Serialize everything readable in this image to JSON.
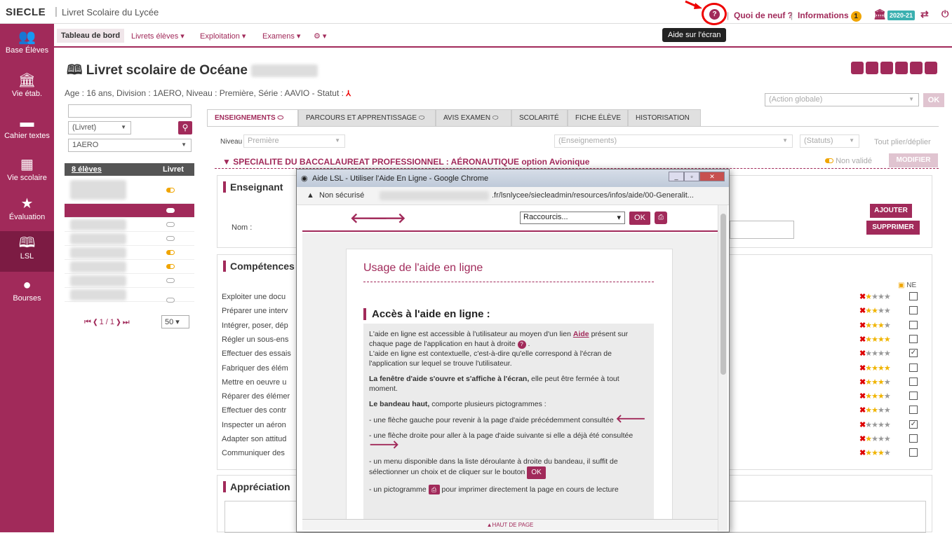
{
  "header": {
    "brand": "SIECLE",
    "separator": "|",
    "app_title": "Livret Scolaire du Lycée",
    "whats_new": "Quoi de neuf ?",
    "divider1": "|",
    "divider2": "|",
    "informations": "Informations",
    "info_count": "1",
    "year": "2020-21",
    "tooltip": "Aide sur l'écran"
  },
  "sidebar": {
    "items": [
      {
        "label": "Base Élèves",
        "icon": "students-icon"
      },
      {
        "label": "Vie étab.",
        "icon": "institution-icon"
      },
      {
        "label": "Cahier textes",
        "icon": "book-icon"
      },
      {
        "label": "Vie scolaire",
        "icon": "calendar-icon"
      },
      {
        "label": "Évaluation",
        "icon": "star-icon"
      },
      {
        "label": "LSL",
        "icon": "open-book-icon"
      },
      {
        "label": "Bourses",
        "icon": "bag-icon"
      }
    ]
  },
  "menu": {
    "dashboard": "Tableau de bord",
    "livrets": "Livrets élèves ▾",
    "exploitation": "Exploitation ▾",
    "examens": "Examens ▾",
    "settings": "⚙ ▾"
  },
  "page": {
    "title": "Livret scolaire de Océane",
    "subinfo": "Age : 16 ans, Division : 1AERO, Niveau : Première, Série : AAVIO - Statut :",
    "action_global": "(Action globale)",
    "ok": "OK"
  },
  "left": {
    "livret_select": "(Livret)",
    "division_select": "1AERO",
    "students_head": "8 élèves",
    "livret_col": "Livret",
    "pager": "⏮ ❮ 1 / 1 ❯ ⏭",
    "per_page": "50"
  },
  "tabs": [
    "ENSEIGNEMENTS",
    "PARCOURS ET APPRENTISSAGE",
    "AVIS EXAMEN",
    "SCOLARITÉ",
    "FICHE ÉLÈVE",
    "HISTORISATION"
  ],
  "filters": {
    "niveau_label": "Niveau",
    "niveau": "Première",
    "enseignements": "(Enseignements)",
    "statuts": "(Statuts)",
    "plier": "Tout plier/déplier"
  },
  "spec": {
    "title": "▼ SPECIALITE DU BACCALAUREAT PROFESSIONNEL : AÉRONAUTIQUE option Avionique",
    "non_valide": "Non validé",
    "modifier": "MODIFIER"
  },
  "enseignant": {
    "title": "Enseignant",
    "nom_label": "Nom :",
    "ajouter": "AJOUTER",
    "supprimer": "SUPPRIMER"
  },
  "competences": {
    "title": "Compétences",
    "ne": "NE",
    "items": [
      {
        "label": "Exploiter une docu",
        "stars": "★★★★",
        "filled": 1,
        "checked": false
      },
      {
        "label": "Préparer une interv",
        "stars": "★★★★",
        "filled": 2,
        "checked": false
      },
      {
        "label": "Intégrer, poser, dép",
        "stars": "★★★★",
        "filled": 3,
        "checked": false
      },
      {
        "label": "Régler un sous-ens",
        "stars": "★★★★",
        "filled": 4,
        "checked": false
      },
      {
        "label": "Effectuer des essais",
        "stars": "★★★★",
        "filled": 0,
        "checked": true
      },
      {
        "label": "Fabriquer des élém",
        "stars": "★★★★",
        "filled": 4,
        "checked": false
      },
      {
        "label": "Mettre en oeuvre u",
        "stars": "★★★★",
        "filled": 3,
        "checked": false
      },
      {
        "label": "Réparer des élémer",
        "stars": "★★★★",
        "filled": 3,
        "checked": false
      },
      {
        "label": "Effectuer des contr",
        "stars": "★★★★",
        "filled": 2,
        "checked": false
      },
      {
        "label": "Inspecter un aéron",
        "stars": "★★★★",
        "filled": 0,
        "checked": true
      },
      {
        "label": "Adapter son attitud",
        "stars": "★★★★",
        "filled": 1,
        "checked": false
      },
      {
        "label": "Communiquer des",
        "stars": "★★★★",
        "filled": 3,
        "checked": false
      }
    ]
  },
  "appreciation": {
    "title": "Appréciation"
  },
  "popup": {
    "window_title": "Aide LSL - Utiliser l'Aide En Ligne - Google Chrome",
    "not_secure": "Non sécurisé",
    "url": ".fr/lsnlycee/siecleadmin/resources/infos/aide/00-Generalit...",
    "shortcuts": "Raccourcis...",
    "ok": "OK",
    "usage_title": "Usage de l'aide en ligne",
    "access_title": "Accès à l'aide en ligne :",
    "p1a": "L'aide en ligne est accessible à l'utilisateur au moyen d'un lien",
    "p1link": "Aide",
    "p1b": "présent sur chaque page de l'application en haut à droite",
    "p1c": "L'aide en ligne est contextuelle, c'est-à-dire qu'elle correspond à l'écran de l'application sur lequel se trouve l'utilisateur.",
    "p2bold": "La fenêtre d'aide s'ouvre et s'affiche à l'écran,",
    "p2": "elle peut être fermée à tout moment.",
    "p3bold": "Le bandeau haut,",
    "p3": "comporte plusieurs pictogrammes :",
    "p4": "- une flèche gauche pour revenir à la page d'aide précédemment consultée",
    "p5": "- une flèche droite pour aller à la page d'aide suivante si elle a déjà été consultée",
    "p6": "- un menu disponible dans la liste déroulante à droite du bandeau, il suffit de sélectionner un choix et de cliquer sur le bouton",
    "p7a": "- un pictogramme",
    "p7b": "pour imprimer directement la page en cours de lecture",
    "footer": "▲HAUT DE PAGE"
  },
  "colors": {
    "accent": "#a12a5a",
    "sidebar": "#a12a5a",
    "badge": "#f0a500",
    "year": "#3bb0b0"
  }
}
